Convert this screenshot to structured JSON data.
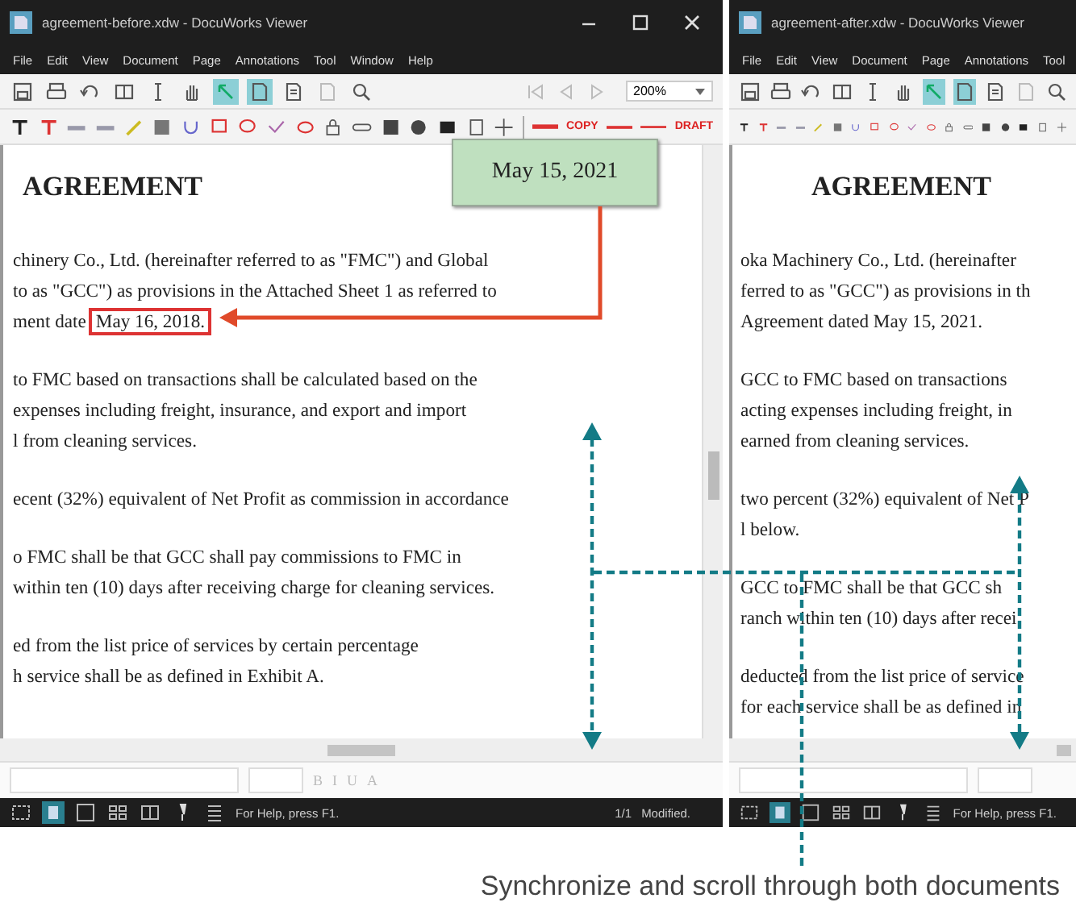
{
  "windows": [
    {
      "title": "agreement-before.xdw - DocuWorks Viewer",
      "window_controls": true,
      "menu": [
        "File",
        "Edit",
        "View",
        "Document",
        "Page",
        "Annotations",
        "Tool",
        "Window",
        "Help"
      ],
      "tools": [
        {
          "kind": "save",
          "selected": false
        },
        {
          "kind": "print",
          "selected": false
        },
        {
          "kind": "rotate",
          "selected": false
        },
        {
          "kind": "columns",
          "selected": false
        },
        {
          "kind": "text-select",
          "selected": false
        },
        {
          "kind": "hand",
          "selected": false
        },
        {
          "kind": "select",
          "selected": true
        },
        {
          "kind": "page",
          "selected": true
        },
        {
          "kind": "document",
          "selected": false
        },
        {
          "kind": "document-dim",
          "selected": false
        },
        {
          "kind": "search",
          "selected": false
        }
      ],
      "navigation": true,
      "zoom": "200%",
      "stamps": [
        "COPY",
        "DRAFT"
      ],
      "document": {
        "title": "AGREEMENT",
        "callout": "May 15, 2021",
        "paragraphs": [
          [
            {
              "text": "chinery Co., Ltd. (hereinafter referred to as \"FMC\") and Global"
            },
            {
              "text": "to as \"GCC\") as provisions in the Attached Sheet 1 as referred to"
            },
            {
              "text": "ment date",
              "boxed": "May 16, 2018."
            }
          ],
          [
            {
              "text": "to FMC based on transactions shall be calculated based on the"
            },
            {
              "text": "expenses including freight, insurance, and export and import"
            },
            {
              "text": "l from cleaning services."
            }
          ],
          [
            {
              "text": "ecent (32%) equivalent of Net Profit as commission in accordance"
            }
          ],
          [
            {
              "text": "o FMC shall be that GCC shall pay commissions to FMC in"
            },
            {
              "text": "within ten (10) days after receiving charge for cleaning services."
            }
          ],
          [
            {
              "text": "ed from the list price of services by certain percentage"
            },
            {
              "text": "h service shall be as defined in Exhibit A."
            }
          ]
        ]
      },
      "format_buttons": [
        "B",
        "I",
        "U",
        "A"
      ],
      "status": "For Help, press F1.",
      "page": "1/1",
      "doc_state": "Modified."
    },
    {
      "title": "agreement-after.xdw - DocuWorks Viewer",
      "window_controls": false,
      "menu": [
        "File",
        "Edit",
        "View",
        "Document",
        "Page",
        "Annotations",
        "Tool"
      ],
      "tools": [
        {
          "kind": "save",
          "selected": false
        },
        {
          "kind": "print",
          "selected": false
        },
        {
          "kind": "rotate",
          "selected": false
        },
        {
          "kind": "columns",
          "selected": false
        },
        {
          "kind": "text-select",
          "selected": false
        },
        {
          "kind": "hand",
          "selected": false
        },
        {
          "kind": "select",
          "selected": true
        },
        {
          "kind": "page",
          "selected": true
        },
        {
          "kind": "document",
          "selected": false
        },
        {
          "kind": "document-dim",
          "selected": false
        },
        {
          "kind": "search",
          "selected": false
        }
      ],
      "navigation": false,
      "document": {
        "title": "AGREEMENT",
        "paragraphs": [
          [
            {
              "text": "oka Machinery Co., Ltd. (hereinafter"
            },
            {
              "text": "ferred to as \"GCC\") as provisions in th"
            },
            {
              "text": "Agreement dated May 15, 2021."
            }
          ],
          [
            {
              "text": "GCC to FMC based on transactions"
            },
            {
              "text": "acting expenses including freight, in"
            },
            {
              "text": "earned from cleaning services."
            }
          ],
          [
            {
              "text": "two percent (32%) equivalent of Net P"
            },
            {
              "text": "l below."
            }
          ],
          [
            {
              "text": "GCC to FMC shall be that GCC sh"
            },
            {
              "text": "ranch within ten (10) days after recei"
            }
          ],
          [
            {
              "text": "deducted from the list price of service"
            },
            {
              "text": "for each service shall be as defined in"
            }
          ]
        ]
      },
      "status": "For Help, press F1."
    }
  ],
  "caption": "Synchronize and scroll through both documents"
}
